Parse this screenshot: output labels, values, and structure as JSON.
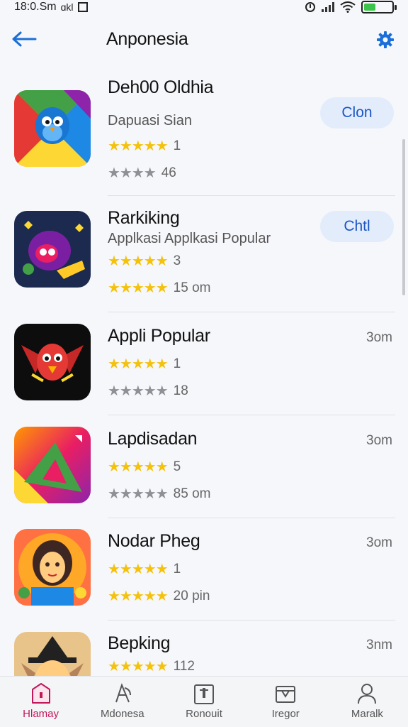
{
  "status_bar": {
    "time": "18:0.Sm",
    "carrier": "ɑkl"
  },
  "header": {
    "title": "Anponesia"
  },
  "apps": [
    {
      "name": "Deh00 Oldhia",
      "subtitle": "Dapuasi Sian",
      "stars_1": "★★★★★",
      "rating_1": "1",
      "stars_2": "★★★★",
      "rating_2": "46",
      "action": "Clon",
      "icon": "colorful-bird-app-icon"
    },
    {
      "name": "Rarkiking",
      "subtitle": "Applkasi Applkasi Popular",
      "stars_1": "★★★★★",
      "rating_1": "3",
      "stars_2": "★★★★★",
      "rating_2": "15 om",
      "action": "Chtl",
      "icon": "purple-monster-app-icon"
    },
    {
      "name": "Appli Popular",
      "stars_1": "★★★★★",
      "rating_1": "1",
      "stars_2": "★★★★★",
      "rating_2": "18",
      "size": "3om",
      "icon": "red-dragon-app-icon"
    },
    {
      "name": "Lapdisadan",
      "stars_1": "★★★★★",
      "rating_1": "5",
      "stars_2": "★★★★★",
      "rating_2": "85 om",
      "size": "3om",
      "icon": "gradient-arrow-app-icon"
    },
    {
      "name": "Nodar Pheg",
      "stars_1": "★★★★★",
      "rating_1": "1",
      "stars_2": "★★★★★",
      "rating_2": "20 pin",
      "size": "3om",
      "icon": "girl-avatar-app-icon"
    },
    {
      "name": "Bepking",
      "stars_1": "★★★★★",
      "rating_1": "112",
      "size": "3nm",
      "icon": "character-hat-app-icon"
    }
  ],
  "nav": [
    {
      "label": "Hlamay",
      "icon": "home-icon"
    },
    {
      "label": "Mdonesa",
      "icon": "games-icon"
    },
    {
      "label": "Ronouit",
      "icon": "apps-icon"
    },
    {
      "label": "Iregor",
      "icon": "category-icon"
    },
    {
      "label": "Maralk",
      "icon": "profile-icon"
    }
  ],
  "colors": {
    "accent": "#1a6fd8",
    "nav_active": "#c2185b",
    "star": "#f4c20d"
  }
}
